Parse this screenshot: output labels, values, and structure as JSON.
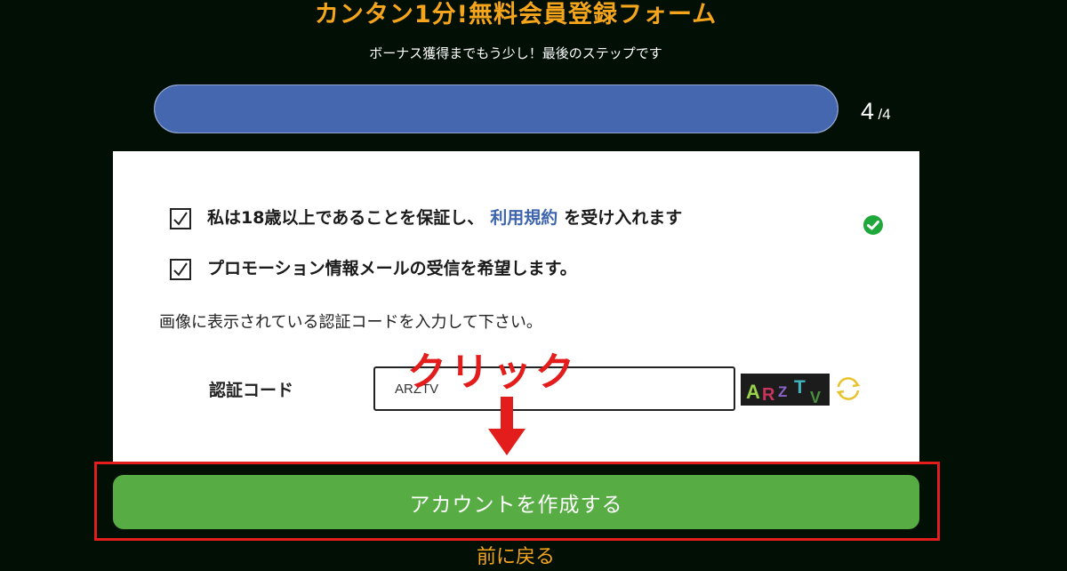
{
  "header": {
    "title": "カンタン1分!無料会員登録フォーム",
    "subtitle": "ボーナス獲得までもう少し！最後のステップです"
  },
  "progress": {
    "current": "4",
    "total": "/4",
    "fraction": 1.0
  },
  "form": {
    "age_check": {
      "text_before": "私は18歳以上であることを保証し、",
      "link_text": "利用規約",
      "text_after": "を受け入れます",
      "checked": true
    },
    "promo_check": {
      "text": "プロモーション情報メールの受信を希望します。",
      "checked": true
    },
    "instruction": "画像に表示されている認証コードを入力して下さい。",
    "code_label": "認証コード",
    "code_value": "ARZTV",
    "captcha_text": "ARZTV"
  },
  "submit_label": "アカウントを作成する",
  "back_label": "前に戻る",
  "annotation": {
    "click_label": "クリック"
  },
  "colors": {
    "background": "#020f05",
    "accent_orange": "#f5a51c",
    "progress_blue": "#4567b0",
    "submit_green": "#57ad44",
    "annotation_red": "#e31c1c",
    "link_blue": "#3d64ad"
  },
  "icons": [
    "check-icon",
    "valid-check-icon",
    "refresh-icon",
    "down-arrow-icon"
  ]
}
